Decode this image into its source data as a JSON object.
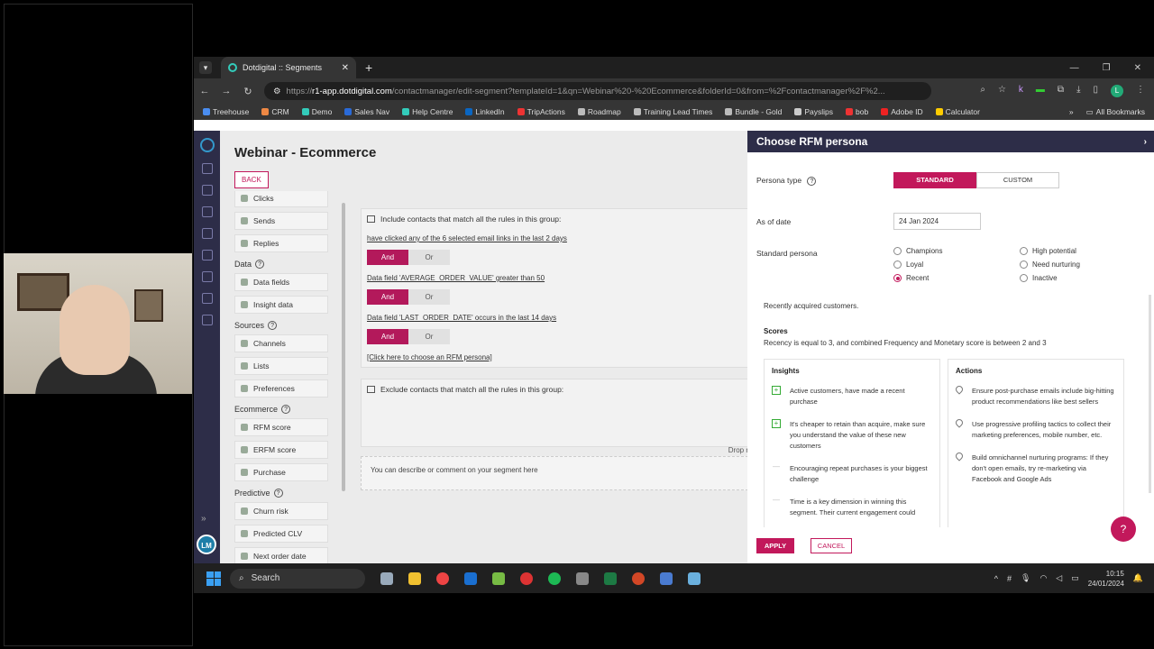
{
  "browser": {
    "tab_title": "Dotdigital :: Segments",
    "url_prefix": "https://",
    "url_host": "r1-app.dotdigital.com",
    "url_path": "/contactmanager/edit-segment?templateId=1&qn=Webinar%20-%20Ecommerce&folderId=0&from=%2Fcontactmanager%2F%2...",
    "profile_initial": "L",
    "ext_initial": "k"
  },
  "bookmarks": [
    {
      "label": "Treehouse",
      "color": "#4a8df0"
    },
    {
      "label": "CRM",
      "color": "#e84"
    },
    {
      "label": "Demo",
      "color": "#3cb"
    },
    {
      "label": "Sales Nav",
      "color": "#2a6ad8"
    },
    {
      "label": "Help Centre",
      "color": "#3cb"
    },
    {
      "label": "LinkedIn",
      "color": "#0a66c2"
    },
    {
      "label": "TripActions",
      "color": "#e33"
    },
    {
      "label": "Roadmap",
      "color": "#bbb"
    },
    {
      "label": "Training Lead Times",
      "color": "#bbb"
    },
    {
      "label": "Bundle - Gold",
      "color": "#bbb"
    },
    {
      "label": "Payslips",
      "color": "#ccc"
    },
    {
      "label": "bob",
      "color": "#e33"
    },
    {
      "label": "Adobe ID",
      "color": "#e22"
    },
    {
      "label": "Calculator",
      "color": "#fc0"
    }
  ],
  "all_bookmarks": "All Bookmarks",
  "page": {
    "title": "Webinar - Ecommerce",
    "back_label": "BACK"
  },
  "sidebar": {
    "items_top": [
      "Clicks",
      "Sends",
      "Replies"
    ],
    "data_heading": "Data",
    "data_items": [
      "Data fields",
      "Insight data"
    ],
    "sources_heading": "Sources",
    "sources_items": [
      "Channels",
      "Lists",
      "Preferences"
    ],
    "ecommerce_heading": "Ecommerce",
    "ecommerce_items": [
      "RFM score",
      "ERFM score",
      "Purchase"
    ],
    "predictive_heading": "Predictive",
    "predictive_items": [
      "Churn risk",
      "Predicted CLV",
      "Next order date"
    ]
  },
  "rules": {
    "include_heading": "Include contacts that match all the rules in this group:",
    "rule1": "have clicked any of the 6 selected email links in the last 2 days",
    "rule2": "Data field 'AVERAGE_ORDER_VALUE' greater than 50",
    "rule3": "Data field 'LAST_ORDER_DATE' occurs in the last 14 days",
    "and_label": "And",
    "or_label": "Or",
    "rfm_link": "[Click here to choose an RFM persona]",
    "exclude_heading": "Exclude contacts that match all the rules in this group:",
    "drop_text": "Drop r",
    "comment_placeholder": "You can describe or comment on your segment here"
  },
  "drawer": {
    "title": "Choose RFM persona",
    "persona_type_label": "Persona type",
    "standard_label": "STANDARD",
    "custom_label": "CUSTOM",
    "as_of_label": "As of date",
    "as_of_value": "24 Jan 2024",
    "standard_persona_label": "Standard persona",
    "personas": [
      {
        "label": "Champions",
        "selected": false
      },
      {
        "label": "Loyal",
        "selected": false
      },
      {
        "label": "Recent",
        "selected": true
      },
      {
        "label": "High potential",
        "selected": false
      },
      {
        "label": "Need nurturing",
        "selected": false
      },
      {
        "label": "Inactive",
        "selected": false
      }
    ],
    "description": "Recently acquired customers.",
    "scores_heading": "Scores",
    "scores_text": "Recency is equal to 3, and combined Frequency and Monetary score is between 2 and 3",
    "insights_heading": "Insights",
    "insights": [
      "Active customers, have made a recent purchase",
      "It's cheaper to retain than acquire, make sure you understand the value of these new customers",
      "Encouraging repeat purchases is your biggest challenge",
      "Time is a key dimension in winning this segment. Their current engagement could"
    ],
    "actions_heading": "Actions",
    "actions": [
      "Ensure post-purchase emails include big-hitting product recommendations like best sellers",
      "Use progressive profiling tactics to collect their marketing preferences, mobile number, etc.",
      "Build omnichannel nurturing programs: If they don't open emails, try re-marketing via Facebook and Google Ads"
    ],
    "apply_label": "APPLY",
    "cancel_label": "CANCEL"
  },
  "app_user_initials": "LM",
  "taskbar": {
    "search_label": "Search",
    "time": "10:15",
    "date": "24/01/2024"
  },
  "colors": {
    "brand": "#c2185b",
    "rail": "#2d2d48"
  }
}
